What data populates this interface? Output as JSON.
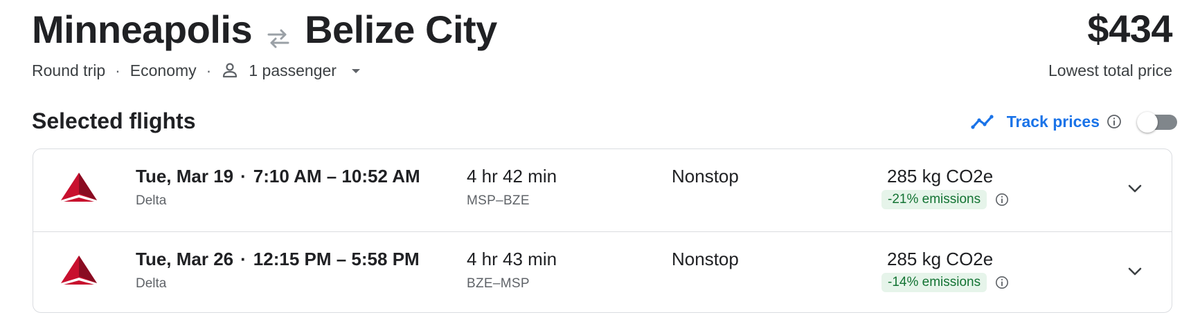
{
  "header": {
    "origin": "Minneapolis",
    "destination": "Belize City",
    "price": "$434",
    "price_caption": "Lowest total price",
    "trip_type": "Round trip",
    "cabin": "Economy",
    "passengers": "1 passenger"
  },
  "section": {
    "title": "Selected flights",
    "track_label": "Track prices",
    "track_enabled": false
  },
  "flights": [
    {
      "date": "Tue, Mar 19",
      "times": "7:10 AM – 10:52 AM",
      "airline": "Delta",
      "duration": "4 hr 42 min",
      "airports": "MSP–BZE",
      "stops": "Nonstop",
      "co2": "285 kg CO2e",
      "emissions": "-21% emissions"
    },
    {
      "date": "Tue, Mar 26",
      "times": "12:15 PM – 5:58 PM",
      "airline": "Delta",
      "duration": "4 hr 43 min",
      "airports": "BZE–MSP",
      "stops": "Nonstop",
      "co2": "285 kg CO2e",
      "emissions": "-14% emissions"
    }
  ],
  "colors": {
    "accent": "#1a73e8",
    "emissions_bg": "#e6f4ea",
    "emissions_text": "#137333",
    "airline_red": "#c8102e"
  },
  "icons": {
    "swap": "swap-arrows-icon",
    "passenger": "person-icon",
    "dropdown": "caret-down-icon",
    "track": "trending-line-icon",
    "info": "info-icon",
    "expand": "chevron-down-icon",
    "airline": "delta-logo"
  }
}
